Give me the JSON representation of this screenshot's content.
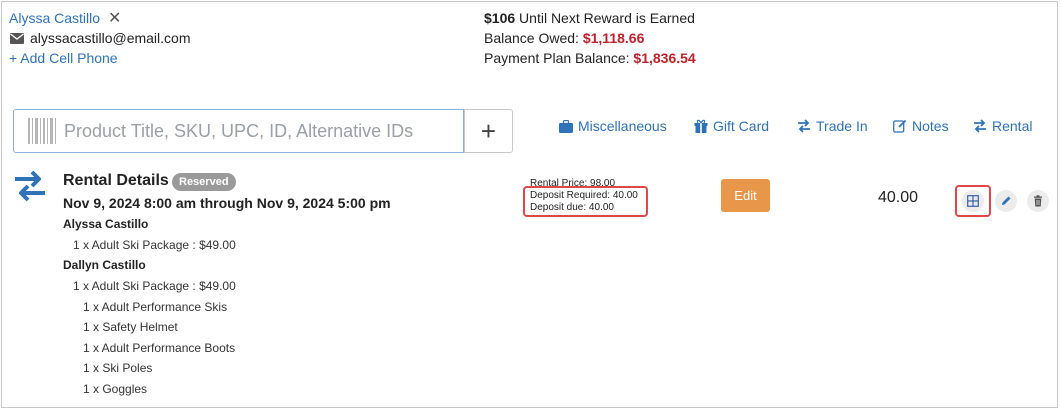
{
  "customer": {
    "name": "Alyssa Castillo",
    "remove_glyph": "✕",
    "email": "alyssacastillo@email.com",
    "add_phone": "+ Add Cell Phone"
  },
  "balances": {
    "reward_amount": "$106",
    "reward_text": "Until Next Reward is Earned",
    "owed_label": "Balance Owed:",
    "owed_value": "$1,118.66",
    "plan_label": "Payment Plan Balance:",
    "plan_value": "$1,836.54"
  },
  "search": {
    "placeholder": "Product Title, SKU, UPC, ID, Alternative IDs",
    "add_label": "+"
  },
  "actions": [
    {
      "label": "Miscellaneous",
      "icon": "briefcase-icon"
    },
    {
      "label": "Gift Card",
      "icon": "gift-icon"
    },
    {
      "label": "Trade In",
      "icon": "exchange-icon"
    },
    {
      "label": "Notes",
      "icon": "edit-note-icon"
    },
    {
      "label": "Rental",
      "icon": "exchange-icon"
    }
  ],
  "rental": {
    "title": "Rental Details",
    "status": "Reserved",
    "dates": "Nov 9, 2024 8:00 am through Nov 9, 2024 5:00 pm",
    "people": [
      {
        "name": "Alyssa Castillo",
        "items": [
          "1 x Adult Ski Package : $49.00"
        ]
      },
      {
        "name": "Dallyn Castillo",
        "items": [
          "1 x Adult Ski Package : $49.00"
        ],
        "sub_items": [
          "1 x Adult Performance Skis",
          "1 x Safety Helmet",
          "1 x Adult Performance Boots",
          "1 x Ski Poles",
          "1 x Goggles"
        ]
      }
    ],
    "price_line": "Rental Price: 98.00",
    "deposit_required": "Deposit Required: 40.00",
    "deposit_due": "Deposit due: 40.00",
    "edit_label": "Edit",
    "amount": "40.00"
  },
  "colors": {
    "link": "#2f72b8",
    "red": "#c0202a",
    "edit": "#e8964a",
    "highlight": "#e04848"
  }
}
